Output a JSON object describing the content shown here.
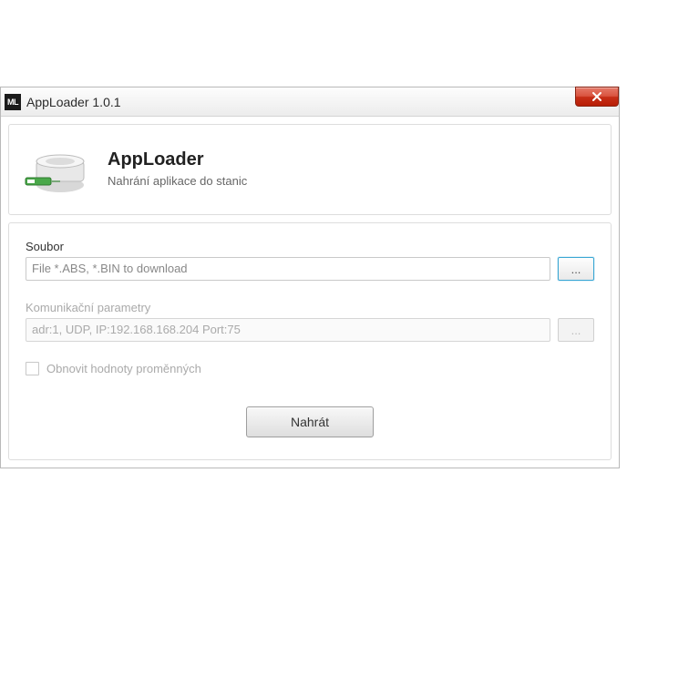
{
  "window": {
    "title": "AppLoader 1.0.1",
    "icon_text": "ML"
  },
  "header": {
    "title": "AppLoader",
    "subtitle": "Nahrání aplikace do stanic"
  },
  "file": {
    "label": "Soubor",
    "placeholder": "File *.ABS, *.BIN to download",
    "browse_label": "..."
  },
  "comm": {
    "label": "Komunikační parametry",
    "value": "adr:1, UDP, IP:192.168.168.204  Port:75",
    "browse_label": "..."
  },
  "restore": {
    "label": "Obnovit hodnoty proměnných",
    "checked": false
  },
  "action": {
    "primary": "Nahrát"
  }
}
